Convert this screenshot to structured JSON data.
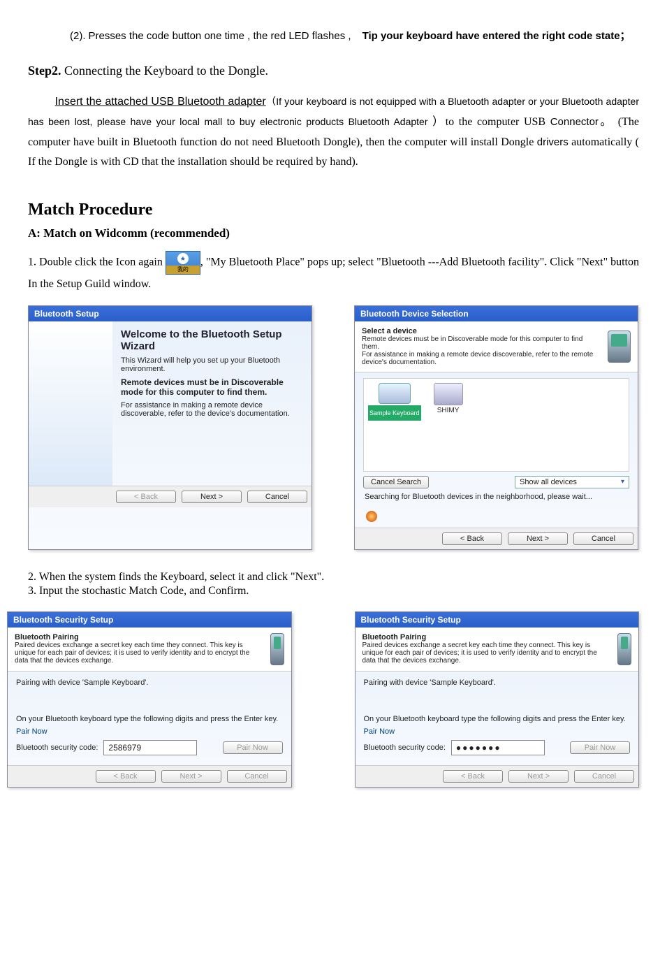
{
  "step1_item": {
    "num": "(2).",
    "text1": "Presses the code button one time , the red LED flashes ,",
    "bold": "Tip your keyboard have entered the right code state；"
  },
  "step2": {
    "heading_bold": "Step2.",
    "heading_rest": " Connecting the Keyboard to the Dongle.",
    "insert": "Insert the attached USB Bluetooth adapter",
    "paren_open": "（",
    "note": "If your keyboard is not equipped with a Bluetooth adapter or your Bluetooth adapter has been lost, please have your local mall to buy electronic products Bluetooth Adapter",
    "paren_close": " ）",
    "rest1": "to the computer USB ",
    "connector": "Connector",
    "rest2": "。  (The computer have built in Bluetooth function do not need Bluetooth Dongle), then the computer will install Dongle ",
    "drivers": "drivers",
    "rest3": " automatically ( If the Dongle is with CD that the installation should be required by hand)."
  },
  "match": {
    "title": "Match Procedure",
    "subA": "A: Match on Widcomm (recommended)",
    "item1_a": "1. Double click the Icon again",
    "item1_b": ", \"My Bluetooth Place\" pops up; select \"Bluetooth ---Add Bluetooth facility\". Click \"Next\" button In the Setup Guild window.",
    "item2": "2. When the system finds the Keyboard, select it and click \"Next\".",
    "item3": "3. Input the stochastic Match Code, and Confirm."
  },
  "bt_icon_label": "我的",
  "shot_setup": {
    "title": "Bluetooth Setup",
    "heading": "Welcome to the Bluetooth Setup Wizard",
    "line1": "This Wizard will help you set up your Bluetooth environment.",
    "bold": "Remote devices must be in Discoverable mode for this computer to find them.",
    "line2": "For assistance in making a remote device discoverable, refer to the device's documentation.",
    "back": "< Back",
    "next": "Next >",
    "cancel": "Cancel"
  },
  "shot_select": {
    "title": "Bluetooth Device Selection",
    "heading": "Select a device",
    "sub1": "Remote devices must be in Discoverable mode for this computer to find them.",
    "sub2": "For assistance in making a remote device discoverable, refer to the remote device's documentation.",
    "dev1": "Sample Keyboard",
    "dev2": "SHIMY",
    "cancel_search": "Cancel Search",
    "show_all": "Show all devices",
    "searching": "Searching for Bluetooth devices in the neighborhood, please wait...",
    "back": "< Back",
    "next": "Next >",
    "cancel": "Cancel"
  },
  "shot_sec": {
    "title": "Bluetooth Security Setup",
    "heading": "Bluetooth Pairing",
    "desc": "Paired devices exchange a secret key each time they connect. This key is unique for each pair of devices; it is used to verify identity and to encrypt the data that the devices exchange.",
    "pairing_with": "Pairing with device 'Sample Keyboard'.",
    "instruct": "On your Bluetooth keyboard type the following digits and press the Enter key.",
    "pair_now": "Pair Now",
    "code_label": "Bluetooth security code:",
    "code_plain": "2586979",
    "code_masked": "●●●●●●●",
    "back": "< Back",
    "next": "Next >",
    "cancel": "Cancel"
  }
}
